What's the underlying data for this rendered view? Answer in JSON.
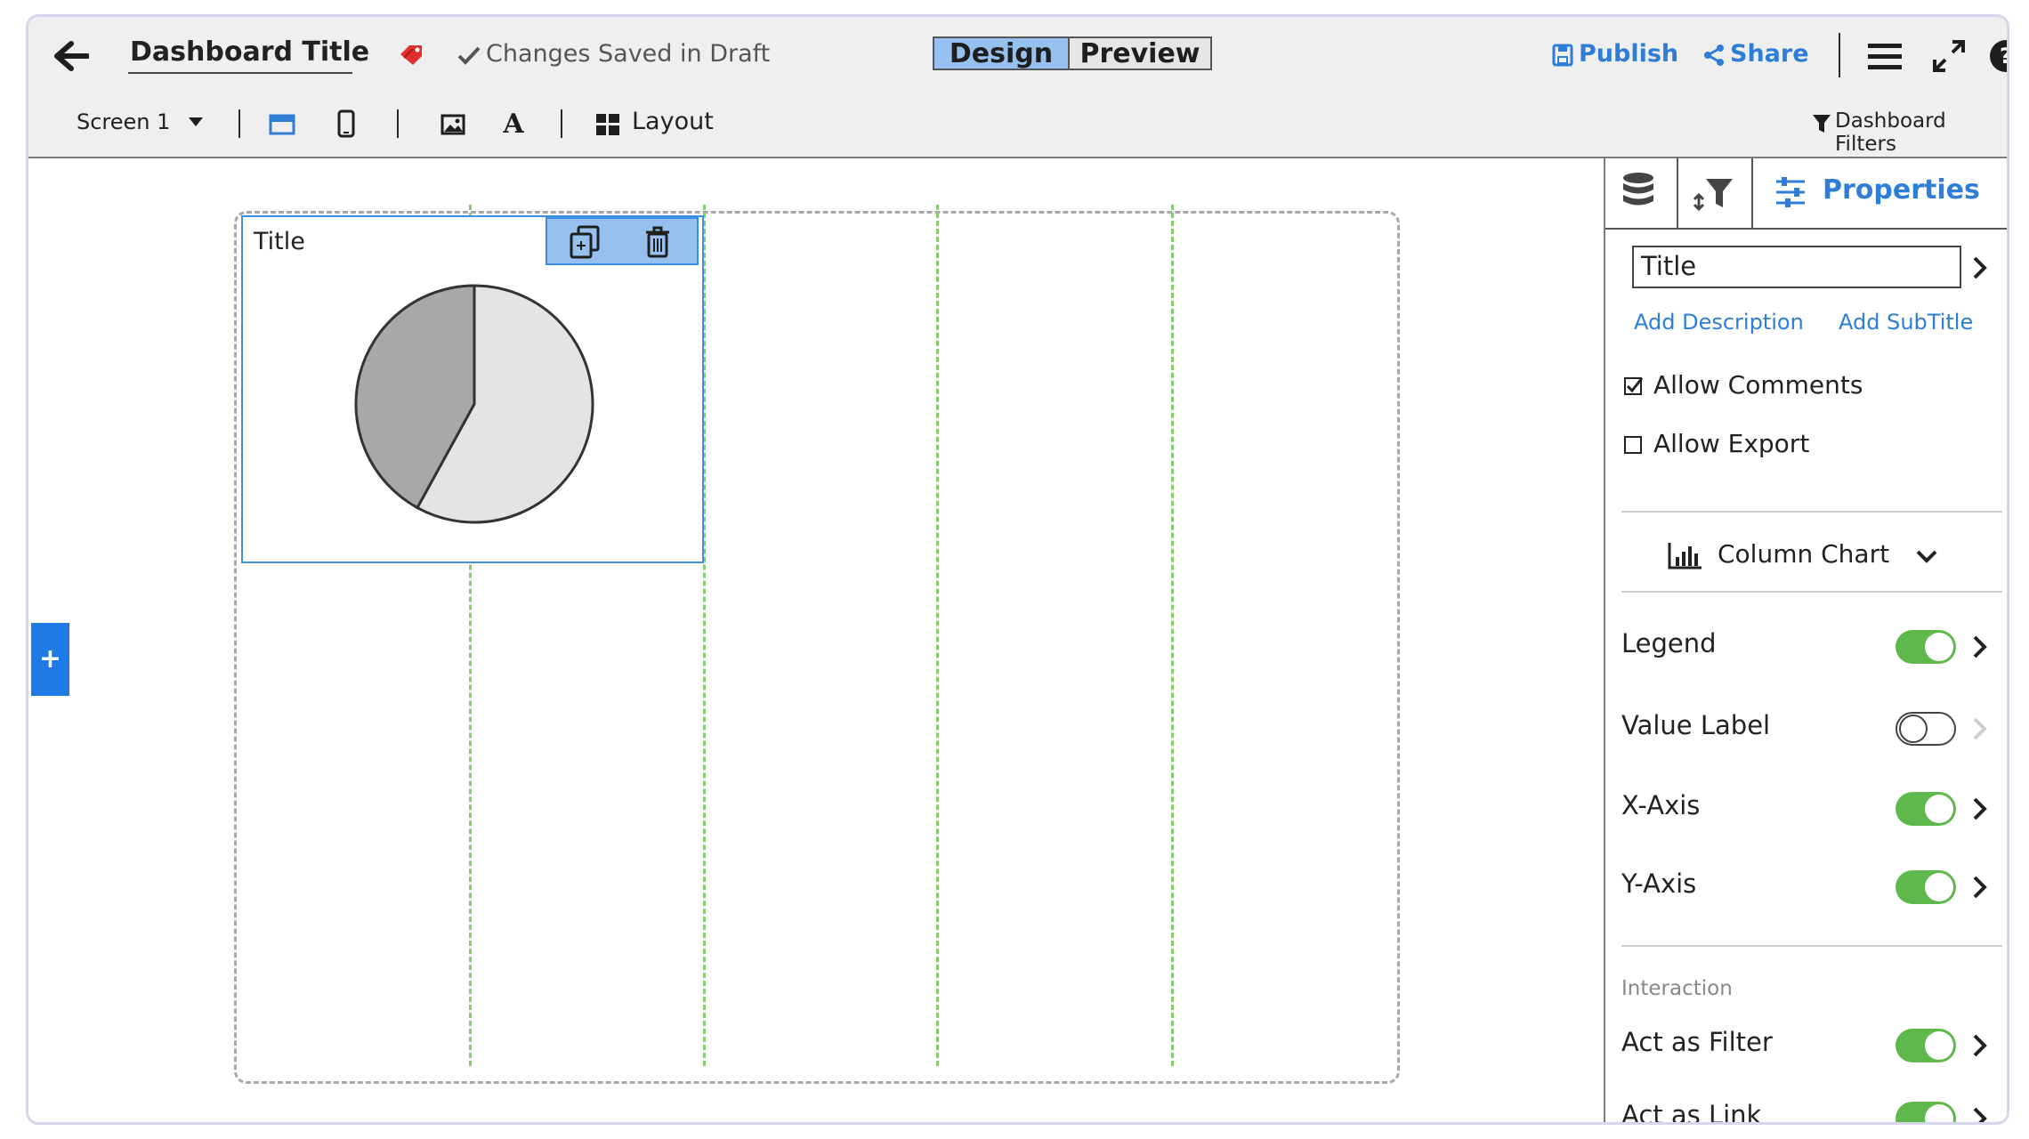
{
  "header": {
    "title": "Dashboard Title",
    "save_status": "Changes Saved in Draft",
    "mode_tabs": [
      {
        "label": "Design",
        "active": true
      },
      {
        "label": "Preview",
        "active": false
      }
    ],
    "publish_label": "Publish",
    "share_label": "Share",
    "icons": [
      "back-arrow-icon",
      "tag-icon",
      "checkmark-icon",
      "publish-save-icon",
      "share-icon",
      "hamburger-menu-icon",
      "fullscreen-icon",
      "help-icon"
    ]
  },
  "toolbar": {
    "screen_select": "Screen 1",
    "layout_label": "Layout",
    "dashboard_filters_label": "Dashboard Filters",
    "icons": [
      "caret-down-icon",
      "desktop-view-icon",
      "mobile-view-icon",
      "image-icon",
      "text-icon",
      "layout-grid-icon",
      "filter-icon"
    ]
  },
  "canvas": {
    "widget": {
      "title": "Title",
      "icons": [
        "duplicate-icon",
        "trash-icon"
      ],
      "chart_data": {
        "type": "pie",
        "title": "",
        "values": [
          0.58,
          0.42
        ],
        "colors": [
          "#e4e4e4",
          "#a8a8a8"
        ]
      }
    },
    "add_button_icon": "plus-icon"
  },
  "properties_panel": {
    "tabs": [
      {
        "icon": "database-icon",
        "label": ""
      },
      {
        "icon": "sort-filter-icon",
        "label": ""
      },
      {
        "icon": "sliders-icon",
        "label": "Properties"
      }
    ],
    "title_input_value": "Title",
    "add_description_label": "Add Description",
    "add_subtitle_label": "Add SubTitle",
    "allow_comments": {
      "label": "Allow Comments",
      "checked": true
    },
    "allow_export": {
      "label": "Allow Export",
      "checked": false
    },
    "chart_type": "Column Chart",
    "options": [
      {
        "label": "Legend",
        "on": true
      },
      {
        "label": "Value Label",
        "on": false
      },
      {
        "label": "X-Axis",
        "on": true
      },
      {
        "label": "Y-Axis",
        "on": true
      }
    ],
    "interaction_heading": "Interaction",
    "interaction_options": [
      {
        "label": "Act as Filter",
        "on": true
      },
      {
        "label": "Act as Link",
        "on": true
      }
    ],
    "colors": {
      "accent": "#2e7dd6",
      "toggle_on": "#5fb84b",
      "selected": "#3b8fe0"
    }
  }
}
